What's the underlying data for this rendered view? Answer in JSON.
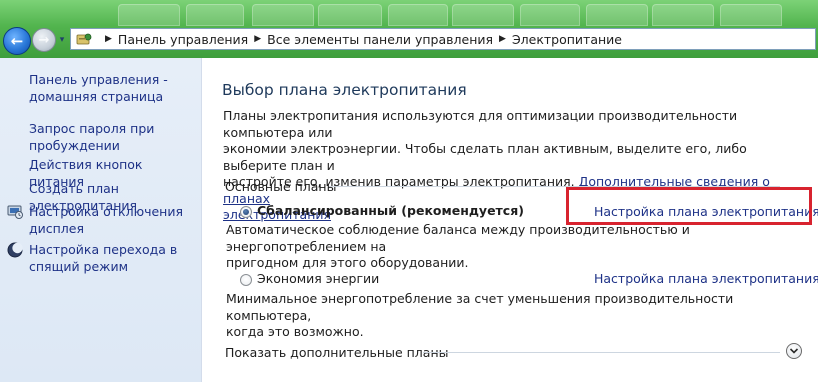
{
  "breadcrumbs": [
    "Панель управления",
    "Все элементы панели управления",
    "Электропитание"
  ],
  "sidebar": {
    "items": [
      {
        "label_lines": [
          "Панель управления -",
          "домашняя страница"
        ],
        "icon": null
      },
      {
        "label_lines": [
          "Запрос пароля при",
          "пробуждении"
        ],
        "icon": null
      },
      {
        "label_lines": [
          "Действия кнопок питания"
        ],
        "icon": null
      },
      {
        "label_lines": [
          "Создать план электропитания"
        ],
        "icon": null
      },
      {
        "label_lines": [
          "Настройка отключения",
          "дисплея"
        ],
        "icon": "monitor-icon"
      },
      {
        "label_lines": [
          "Настройка перехода в",
          "спящий режим"
        ],
        "icon": "moon-icon"
      }
    ]
  },
  "main": {
    "title": "Выбор плана электропитания",
    "intro_lines": [
      "Планы электропитания используются для оптимизации производительности компьютера или",
      "экономии электроэнергии. Чтобы сделать план активным, выделите его, либо выберите план и",
      "настройте его, изменив параметры электропитания. "
    ],
    "intro_link_1": "Дополнительные сведения о планах",
    "intro_link_2": "электропитания",
    "group_label": "Основные планы",
    "plans": [
      {
        "name": "Сбалансированный (рекомендуется)",
        "selected": true,
        "link": "Настройка плана электропитания",
        "desc_lines": [
          "Автоматическое соблюдение баланса между производительностью и энергопотреблением на",
          "пригодном для этого оборудовании."
        ]
      },
      {
        "name": "Экономия энергии",
        "selected": false,
        "link": "Настройка плана электропитания",
        "desc_lines": [
          "Минимальное энергопотребление за счет уменьшения производительности компьютера,",
          "когда это возможно."
        ]
      }
    ],
    "more_plans_label": "Показать дополнительные планы"
  },
  "colors": {
    "link": "#1e3287",
    "title": "#1e395b",
    "highlight": "#d8232f",
    "sidebar_bg": "#e6eef8",
    "titlebar": "#52b44e"
  }
}
